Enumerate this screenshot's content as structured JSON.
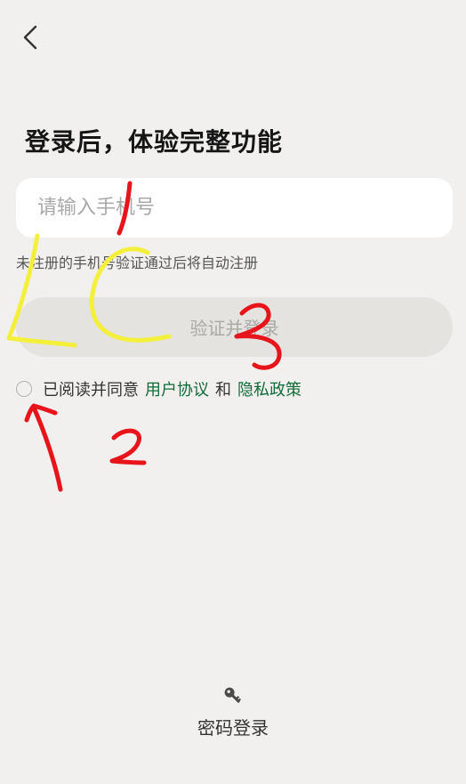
{
  "header": {
    "back_icon": "chevron-left-icon"
  },
  "main": {
    "title": "登录后，体验完整功能",
    "phone_placeholder": "请输入手机号",
    "phone_value": "",
    "hint": "未注册的手机号验证通过后将自动注册",
    "verify_button": "验证并登录",
    "agreement": {
      "prefix": "已阅读并同意",
      "user_agreement": "用户协议",
      "and": "和",
      "privacy_policy": "隐私政策"
    }
  },
  "footer": {
    "password_login_icon": "key-icon",
    "password_login_label": "密码登录"
  },
  "annotations": {
    "marks": [
      "1",
      "2",
      "3"
    ],
    "colors": {
      "red": "#e8141b",
      "yellow": "#f4ef3a"
    }
  },
  "colors": {
    "background": "#f1f0ee",
    "link": "#0f6b3a",
    "button_disabled_bg": "#e4e3df",
    "button_disabled_text": "#a9a9a6"
  }
}
